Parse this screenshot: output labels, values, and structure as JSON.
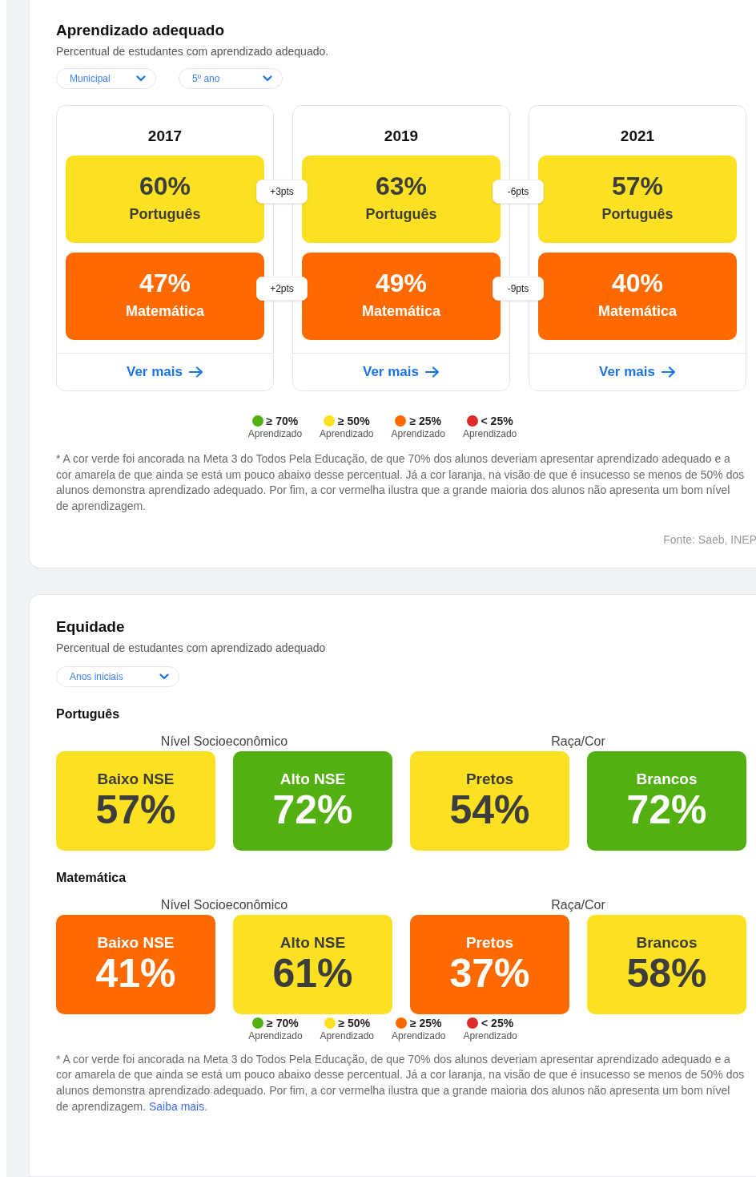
{
  "learning": {
    "title": "Aprendizado adequado",
    "subtitle": "Percentual de estudantes com aprendizado adequado.",
    "filters": [
      {
        "value": "Municipal"
      },
      {
        "value": "5º ano"
      }
    ],
    "years": [
      {
        "year": "2017",
        "tiles": [
          {
            "value": "60%",
            "subject": "Português",
            "kind": "yellow"
          },
          {
            "value": "47%",
            "subject": "Matemática",
            "kind": "orange"
          }
        ],
        "link": "Ver mais"
      },
      {
        "year": "2019",
        "tiles": [
          {
            "value": "63%",
            "subject": "Português",
            "kind": "yellow"
          },
          {
            "value": "49%",
            "subject": "Matemática",
            "kind": "orange"
          }
        ],
        "link": "Ver mais"
      },
      {
        "year": "2021",
        "tiles": [
          {
            "value": "57%",
            "subject": "Português",
            "kind": "yellow"
          },
          {
            "value": "40%",
            "subject": "Matemática",
            "kind": "orange"
          }
        ],
        "link": "Ver mais"
      }
    ],
    "deltas": [
      [
        "+3pts",
        "+2pts"
      ],
      [
        "-6pts",
        "-9pts"
      ]
    ],
    "legend": [
      {
        "range": "≥ 70%",
        "label": "Aprendizado",
        "color": "#52b012"
      },
      {
        "range": "≥ 50%",
        "label": "Aprendizado",
        "color": "#fbe121"
      },
      {
        "range": "≥ 25%",
        "label": "Aprendizado",
        "color": "#ff6a00"
      },
      {
        "range": "< 25%",
        "label": "Aprendizado",
        "color": "#e02a2a"
      }
    ],
    "footnote": "* A cor verde foi ancorada na Meta 3 do Todos Pela Educação, de que 70% dos alunos deveriam apresentar aprendizado adequado e a cor amarela de que ainda se está um pouco abaixo desse percentual. Já a cor laranja, na visão de que é insucesso se menos de 50% dos alunos demonstra aprendizado adequado. Por fim, a cor vermelha ilustra que a grande maioria dos alunos não apresenta um bom nível de aprendizagem.",
    "source": "Fonte: Saeb, INEP"
  },
  "equity": {
    "title": "Equidade",
    "subtitle": "Percentual de estudantes com aprendizado adequado",
    "filters": [
      {
        "value": "Anos iniciais"
      }
    ],
    "subjects": [
      {
        "name": "Português",
        "groups": [
          {
            "label": "Nível Socioeconômico",
            "tiles": [
              {
                "label": "Baixo NSE",
                "value": "57%",
                "kind": "yellow"
              },
              {
                "label": "Alto NSE",
                "value": "72%",
                "kind": "green"
              }
            ]
          },
          {
            "label": "Raça/Cor",
            "tiles": [
              {
                "label": "Pretos",
                "value": "54%",
                "kind": "yellow"
              },
              {
                "label": "Brancos",
                "value": "72%",
                "kind": "green"
              }
            ]
          }
        ]
      },
      {
        "name": "Matemática",
        "groups": [
          {
            "label": "Nível Socioeconômico",
            "tiles": [
              {
                "label": "Baixo NSE",
                "value": "41%",
                "kind": "orange"
              },
              {
                "label": "Alto NSE",
                "value": "61%",
                "kind": "yellow"
              }
            ]
          },
          {
            "label": "Raça/Cor",
            "tiles": [
              {
                "label": "Pretos",
                "value": "37%",
                "kind": "orange"
              },
              {
                "label": "Brancos",
                "value": "58%",
                "kind": "yellow"
              }
            ]
          }
        ]
      }
    ],
    "legend": [
      {
        "range": "≥ 70%",
        "label": "Aprendizado",
        "color": "#52b012"
      },
      {
        "range": "≥ 50%",
        "label": "Aprendizado",
        "color": "#fbe121"
      },
      {
        "range": "≥ 25%",
        "label": "Aprendizado",
        "color": "#ff6a00"
      },
      {
        "range": "< 25%",
        "label": "Aprendizado",
        "color": "#e02a2a"
      }
    ],
    "footnote": "* A cor verde foi ancorada na Meta 3 do Todos Pela Educação, de que 70% dos alunos deveriam apresentar aprendizado adequado e a cor amarela de que ainda se está um pouco abaixo desse percentual. Já a cor laranja, na visão de que é insucesso se menos de 50% dos alunos demonstra aprendizado adequado. Por fim, a cor vermelha ilustra que a grande maioria dos alunos não apresenta um bom nível de aprendizagem.",
    "link": "Saiba mais."
  }
}
